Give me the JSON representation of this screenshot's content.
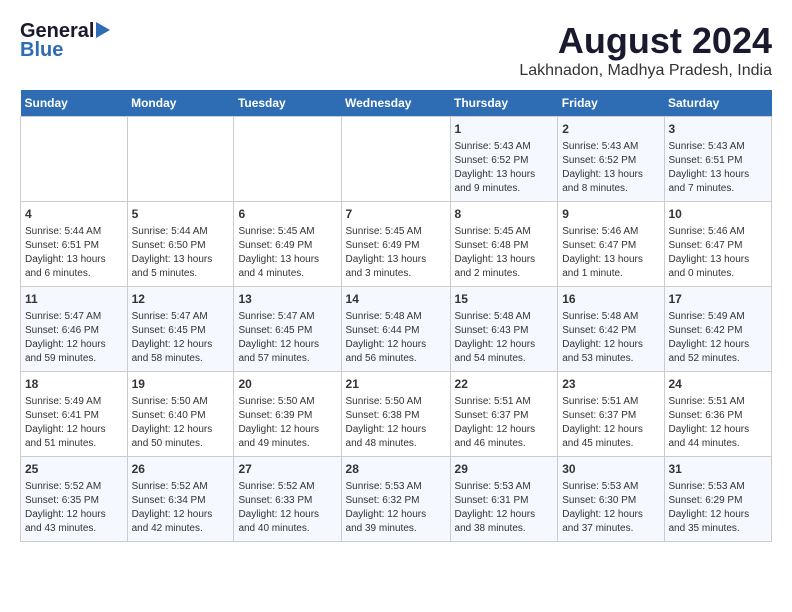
{
  "logo": {
    "general": "General",
    "blue": "Blue"
  },
  "title": "August 2024",
  "subtitle": "Lakhnadon, Madhya Pradesh, India",
  "days_header": [
    "Sunday",
    "Monday",
    "Tuesday",
    "Wednesday",
    "Thursday",
    "Friday",
    "Saturday"
  ],
  "weeks": [
    [
      {
        "day": "",
        "info": ""
      },
      {
        "day": "",
        "info": ""
      },
      {
        "day": "",
        "info": ""
      },
      {
        "day": "",
        "info": ""
      },
      {
        "day": "1",
        "info": "Sunrise: 5:43 AM\nSunset: 6:52 PM\nDaylight: 13 hours\nand 9 minutes."
      },
      {
        "day": "2",
        "info": "Sunrise: 5:43 AM\nSunset: 6:52 PM\nDaylight: 13 hours\nand 8 minutes."
      },
      {
        "day": "3",
        "info": "Sunrise: 5:43 AM\nSunset: 6:51 PM\nDaylight: 13 hours\nand 7 minutes."
      }
    ],
    [
      {
        "day": "4",
        "info": "Sunrise: 5:44 AM\nSunset: 6:51 PM\nDaylight: 13 hours\nand 6 minutes."
      },
      {
        "day": "5",
        "info": "Sunrise: 5:44 AM\nSunset: 6:50 PM\nDaylight: 13 hours\nand 5 minutes."
      },
      {
        "day": "6",
        "info": "Sunrise: 5:45 AM\nSunset: 6:49 PM\nDaylight: 13 hours\nand 4 minutes."
      },
      {
        "day": "7",
        "info": "Sunrise: 5:45 AM\nSunset: 6:49 PM\nDaylight: 13 hours\nand 3 minutes."
      },
      {
        "day": "8",
        "info": "Sunrise: 5:45 AM\nSunset: 6:48 PM\nDaylight: 13 hours\nand 2 minutes."
      },
      {
        "day": "9",
        "info": "Sunrise: 5:46 AM\nSunset: 6:47 PM\nDaylight: 13 hours\nand 1 minute."
      },
      {
        "day": "10",
        "info": "Sunrise: 5:46 AM\nSunset: 6:47 PM\nDaylight: 13 hours\nand 0 minutes."
      }
    ],
    [
      {
        "day": "11",
        "info": "Sunrise: 5:47 AM\nSunset: 6:46 PM\nDaylight: 12 hours\nand 59 minutes."
      },
      {
        "day": "12",
        "info": "Sunrise: 5:47 AM\nSunset: 6:45 PM\nDaylight: 12 hours\nand 58 minutes."
      },
      {
        "day": "13",
        "info": "Sunrise: 5:47 AM\nSunset: 6:45 PM\nDaylight: 12 hours\nand 57 minutes."
      },
      {
        "day": "14",
        "info": "Sunrise: 5:48 AM\nSunset: 6:44 PM\nDaylight: 12 hours\nand 56 minutes."
      },
      {
        "day": "15",
        "info": "Sunrise: 5:48 AM\nSunset: 6:43 PM\nDaylight: 12 hours\nand 54 minutes."
      },
      {
        "day": "16",
        "info": "Sunrise: 5:48 AM\nSunset: 6:42 PM\nDaylight: 12 hours\nand 53 minutes."
      },
      {
        "day": "17",
        "info": "Sunrise: 5:49 AM\nSunset: 6:42 PM\nDaylight: 12 hours\nand 52 minutes."
      }
    ],
    [
      {
        "day": "18",
        "info": "Sunrise: 5:49 AM\nSunset: 6:41 PM\nDaylight: 12 hours\nand 51 minutes."
      },
      {
        "day": "19",
        "info": "Sunrise: 5:50 AM\nSunset: 6:40 PM\nDaylight: 12 hours\nand 50 minutes."
      },
      {
        "day": "20",
        "info": "Sunrise: 5:50 AM\nSunset: 6:39 PM\nDaylight: 12 hours\nand 49 minutes."
      },
      {
        "day": "21",
        "info": "Sunrise: 5:50 AM\nSunset: 6:38 PM\nDaylight: 12 hours\nand 48 minutes."
      },
      {
        "day": "22",
        "info": "Sunrise: 5:51 AM\nSunset: 6:37 PM\nDaylight: 12 hours\nand 46 minutes."
      },
      {
        "day": "23",
        "info": "Sunrise: 5:51 AM\nSunset: 6:37 PM\nDaylight: 12 hours\nand 45 minutes."
      },
      {
        "day": "24",
        "info": "Sunrise: 5:51 AM\nSunset: 6:36 PM\nDaylight: 12 hours\nand 44 minutes."
      }
    ],
    [
      {
        "day": "25",
        "info": "Sunrise: 5:52 AM\nSunset: 6:35 PM\nDaylight: 12 hours\nand 43 minutes."
      },
      {
        "day": "26",
        "info": "Sunrise: 5:52 AM\nSunset: 6:34 PM\nDaylight: 12 hours\nand 42 minutes."
      },
      {
        "day": "27",
        "info": "Sunrise: 5:52 AM\nSunset: 6:33 PM\nDaylight: 12 hours\nand 40 minutes."
      },
      {
        "day": "28",
        "info": "Sunrise: 5:53 AM\nSunset: 6:32 PM\nDaylight: 12 hours\nand 39 minutes."
      },
      {
        "day": "29",
        "info": "Sunrise: 5:53 AM\nSunset: 6:31 PM\nDaylight: 12 hours\nand 38 minutes."
      },
      {
        "day": "30",
        "info": "Sunrise: 5:53 AM\nSunset: 6:30 PM\nDaylight: 12 hours\nand 37 minutes."
      },
      {
        "day": "31",
        "info": "Sunrise: 5:53 AM\nSunset: 6:29 PM\nDaylight: 12 hours\nand 35 minutes."
      }
    ]
  ]
}
